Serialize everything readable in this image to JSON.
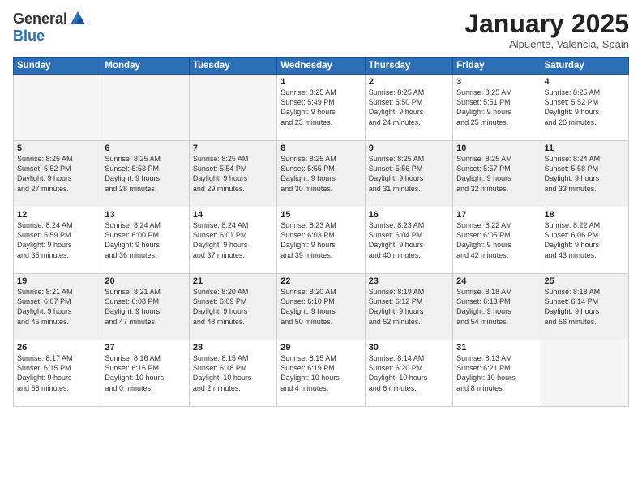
{
  "logo": {
    "general": "General",
    "blue": "Blue"
  },
  "title": "January 2025",
  "subtitle": "Alpuente, Valencia, Spain",
  "days_of_week": [
    "Sunday",
    "Monday",
    "Tuesday",
    "Wednesday",
    "Thursday",
    "Friday",
    "Saturday"
  ],
  "weeks": [
    [
      {
        "day": "",
        "info": ""
      },
      {
        "day": "",
        "info": ""
      },
      {
        "day": "",
        "info": ""
      },
      {
        "day": "1",
        "info": "Sunrise: 8:25 AM\nSunset: 5:49 PM\nDaylight: 9 hours\nand 23 minutes."
      },
      {
        "day": "2",
        "info": "Sunrise: 8:25 AM\nSunset: 5:50 PM\nDaylight: 9 hours\nand 24 minutes."
      },
      {
        "day": "3",
        "info": "Sunrise: 8:25 AM\nSunset: 5:51 PM\nDaylight: 9 hours\nand 25 minutes."
      },
      {
        "day": "4",
        "info": "Sunrise: 8:25 AM\nSunset: 5:52 PM\nDaylight: 9 hours\nand 26 minutes."
      }
    ],
    [
      {
        "day": "5",
        "info": "Sunrise: 8:25 AM\nSunset: 5:52 PM\nDaylight: 9 hours\nand 27 minutes."
      },
      {
        "day": "6",
        "info": "Sunrise: 8:25 AM\nSunset: 5:53 PM\nDaylight: 9 hours\nand 28 minutes."
      },
      {
        "day": "7",
        "info": "Sunrise: 8:25 AM\nSunset: 5:54 PM\nDaylight: 9 hours\nand 29 minutes."
      },
      {
        "day": "8",
        "info": "Sunrise: 8:25 AM\nSunset: 5:55 PM\nDaylight: 9 hours\nand 30 minutes."
      },
      {
        "day": "9",
        "info": "Sunrise: 8:25 AM\nSunset: 5:56 PM\nDaylight: 9 hours\nand 31 minutes."
      },
      {
        "day": "10",
        "info": "Sunrise: 8:25 AM\nSunset: 5:57 PM\nDaylight: 9 hours\nand 32 minutes."
      },
      {
        "day": "11",
        "info": "Sunrise: 8:24 AM\nSunset: 5:58 PM\nDaylight: 9 hours\nand 33 minutes."
      }
    ],
    [
      {
        "day": "12",
        "info": "Sunrise: 8:24 AM\nSunset: 5:59 PM\nDaylight: 9 hours\nand 35 minutes."
      },
      {
        "day": "13",
        "info": "Sunrise: 8:24 AM\nSunset: 6:00 PM\nDaylight: 9 hours\nand 36 minutes."
      },
      {
        "day": "14",
        "info": "Sunrise: 8:24 AM\nSunset: 6:01 PM\nDaylight: 9 hours\nand 37 minutes."
      },
      {
        "day": "15",
        "info": "Sunrise: 8:23 AM\nSunset: 6:03 PM\nDaylight: 9 hours\nand 39 minutes."
      },
      {
        "day": "16",
        "info": "Sunrise: 8:23 AM\nSunset: 6:04 PM\nDaylight: 9 hours\nand 40 minutes."
      },
      {
        "day": "17",
        "info": "Sunrise: 8:22 AM\nSunset: 6:05 PM\nDaylight: 9 hours\nand 42 minutes."
      },
      {
        "day": "18",
        "info": "Sunrise: 8:22 AM\nSunset: 6:06 PM\nDaylight: 9 hours\nand 43 minutes."
      }
    ],
    [
      {
        "day": "19",
        "info": "Sunrise: 8:21 AM\nSunset: 6:07 PM\nDaylight: 9 hours\nand 45 minutes."
      },
      {
        "day": "20",
        "info": "Sunrise: 8:21 AM\nSunset: 6:08 PM\nDaylight: 9 hours\nand 47 minutes."
      },
      {
        "day": "21",
        "info": "Sunrise: 8:20 AM\nSunset: 6:09 PM\nDaylight: 9 hours\nand 48 minutes."
      },
      {
        "day": "22",
        "info": "Sunrise: 8:20 AM\nSunset: 6:10 PM\nDaylight: 9 hours\nand 50 minutes."
      },
      {
        "day": "23",
        "info": "Sunrise: 8:19 AM\nSunset: 6:12 PM\nDaylight: 9 hours\nand 52 minutes."
      },
      {
        "day": "24",
        "info": "Sunrise: 8:18 AM\nSunset: 6:13 PM\nDaylight: 9 hours\nand 54 minutes."
      },
      {
        "day": "25",
        "info": "Sunrise: 8:18 AM\nSunset: 6:14 PM\nDaylight: 9 hours\nand 56 minutes."
      }
    ],
    [
      {
        "day": "26",
        "info": "Sunrise: 8:17 AM\nSunset: 6:15 PM\nDaylight: 9 hours\nand 58 minutes."
      },
      {
        "day": "27",
        "info": "Sunrise: 8:16 AM\nSunset: 6:16 PM\nDaylight: 10 hours\nand 0 minutes."
      },
      {
        "day": "28",
        "info": "Sunrise: 8:15 AM\nSunset: 6:18 PM\nDaylight: 10 hours\nand 2 minutes."
      },
      {
        "day": "29",
        "info": "Sunrise: 8:15 AM\nSunset: 6:19 PM\nDaylight: 10 hours\nand 4 minutes."
      },
      {
        "day": "30",
        "info": "Sunrise: 8:14 AM\nSunset: 6:20 PM\nDaylight: 10 hours\nand 6 minutes."
      },
      {
        "day": "31",
        "info": "Sunrise: 8:13 AM\nSunset: 6:21 PM\nDaylight: 10 hours\nand 8 minutes."
      },
      {
        "day": "",
        "info": ""
      }
    ]
  ]
}
